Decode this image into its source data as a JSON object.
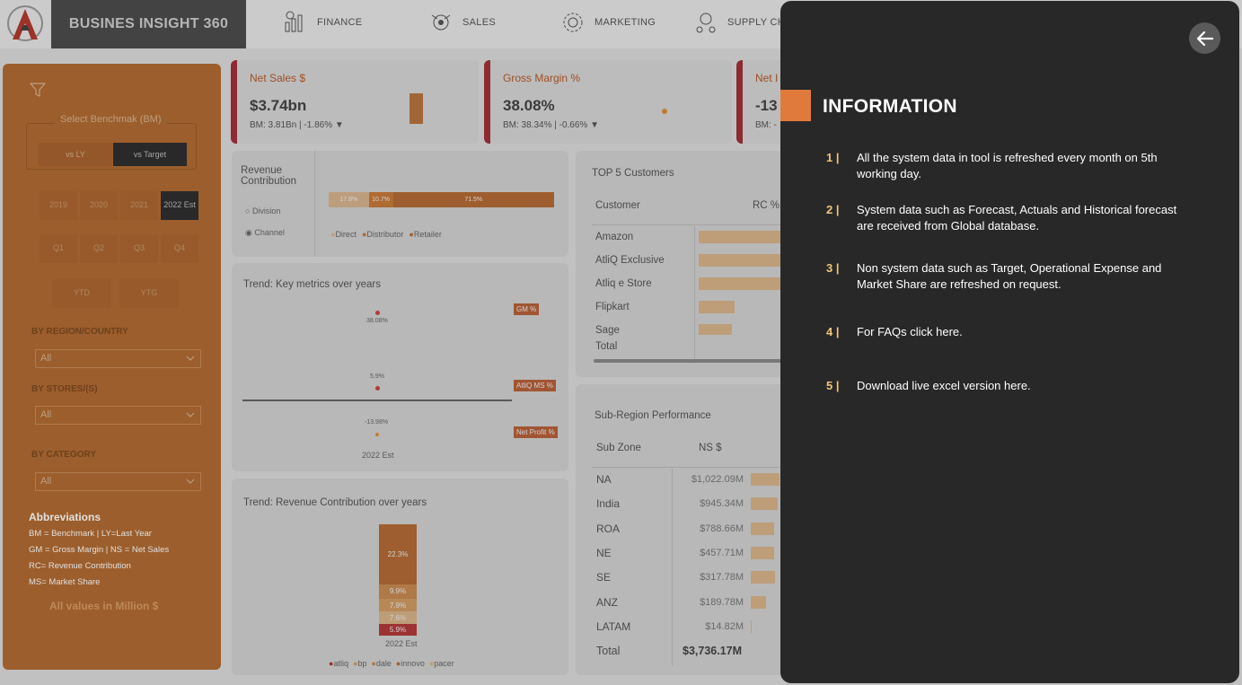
{
  "app": {
    "brand": "BUSINES INSIGHT 360",
    "nav": [
      {
        "label": "FINANCE",
        "icon": "finance-icon"
      },
      {
        "label": "SALES",
        "icon": "sales-icon"
      },
      {
        "label": "MARKETING",
        "icon": "marketing-icon"
      },
      {
        "label": "SUPPLY CHA",
        "icon": "supply-chain-icon"
      }
    ]
  },
  "sidebar": {
    "benchmark_title": "Select Benchmak (BM)",
    "benchmark_options": [
      "vs LY",
      "vs Target"
    ],
    "benchmark_selected": "vs Target",
    "years": [
      "2019",
      "2020",
      "2021",
      "2022 Est"
    ],
    "year_selected": "2022 Est",
    "quarters": [
      "Q1",
      "Q2",
      "Q3",
      "Q4"
    ],
    "ytd": "YTD",
    "ytg": "YTG",
    "filters": [
      {
        "label": "BY REGION/COUNTRY",
        "value": "All"
      },
      {
        "label": "BY STORES/(S)",
        "value": "All"
      },
      {
        "label": "BY CATEGORY",
        "value": "All"
      }
    ],
    "abbreviations_title": "Abbreviations",
    "abbreviations": [
      "BM = Benchmark | LY=Last Year",
      "GM = Gross Margin | NS = Net Sales",
      "RC= Revenue Contribution",
      "MS= Market Share"
    ],
    "all_values_note": "All values in Million $"
  },
  "kpis": [
    {
      "title": "Net Sales $",
      "value": "$3.74bn",
      "sub": "BM: 3.81Bn | -1.86% ▼"
    },
    {
      "title": "Gross Margin %",
      "value": "38.08%",
      "sub": "BM: 38.34% | -0.66% ▼"
    },
    {
      "title": "Net I",
      "value": "-13",
      "sub": "BM: -"
    }
  ],
  "revenue_contribution": {
    "title": "Revenue Contribution",
    "options": [
      "Division",
      "Channel"
    ],
    "selected": "Channel",
    "bar_labels": [
      "17.8%",
      "10.7%",
      "71.5%"
    ],
    "legend": [
      "Direct",
      "Distributor",
      "Retailer"
    ]
  },
  "trend_metrics": {
    "title": "Trend: Key metrics over years",
    "values": [
      "38.08%",
      "5.9%",
      "-13.98%"
    ],
    "labels": [
      "GM %",
      "AtliQ MS %",
      "Net Profit %"
    ],
    "x_label": "2022 Est"
  },
  "trend_rc": {
    "title": "Trend: Revenue Contribution over years",
    "segments": [
      "22.3%",
      "9.9%",
      "7.9%",
      "7.6%",
      "5.9%"
    ],
    "x_label": "2022 Est",
    "legend": [
      "atliq",
      "bp",
      "dale",
      "innovo",
      "pacer"
    ]
  },
  "top_customers": {
    "title": "TOP 5 Customers",
    "headers": [
      "Customer",
      "RC %"
    ],
    "rows": [
      "Amazon",
      "AtliQ Exclusive",
      "Atliq e Store",
      "Flipkart",
      "Sage"
    ],
    "total": "Total"
  },
  "subregion": {
    "title": "Sub-Region Performance",
    "headers": [
      "Sub Zone",
      "NS $"
    ],
    "rows": [
      {
        "zone": "NA",
        "ns": "$1,022.09M"
      },
      {
        "zone": "India",
        "ns": "$945.34M"
      },
      {
        "zone": "ROA",
        "ns": "$788.66M"
      },
      {
        "zone": "NE",
        "ns": "$457.71M"
      },
      {
        "zone": "SE",
        "ns": "$317.78M"
      },
      {
        "zone": "ANZ",
        "ns": "$189.78M"
      },
      {
        "zone": "LATAM",
        "ns": "$14.82M"
      }
    ],
    "total_label": "Total",
    "total_value": "$3,736.17M"
  },
  "info_panel": {
    "title": "INFORMATION",
    "items": [
      {
        "num": "1 |",
        "text": "All the system data in tool is refreshed every month on 5th working day."
      },
      {
        "num": "2 |",
        "text": "System data such as Forecast, Actuals and Historical forecast are received from Global database."
      },
      {
        "num": "3 |",
        "text": "Non system data such as Target, Operational Expense and Market Share are refreshed on request."
      },
      {
        "num": "4 |",
        "text": "For FAQs click here."
      },
      {
        "num": "5 |",
        "text": "Download live excel version here."
      }
    ],
    "accent_color": "#e07a3c",
    "number_color": "#f3c57a"
  }
}
